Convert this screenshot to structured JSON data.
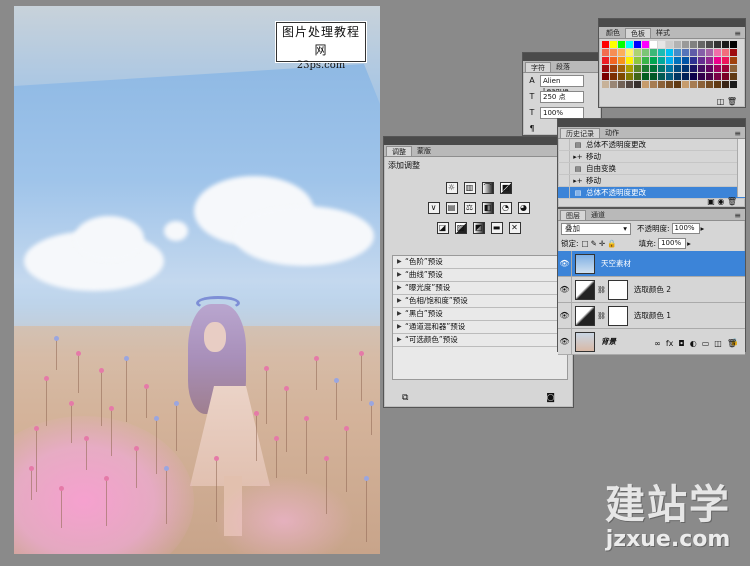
{
  "watermark": {
    "line1": "图片处理教程网",
    "line2": "23ps.com"
  },
  "adjustments": {
    "tabs": [
      "调整",
      "蒙版"
    ],
    "heading": "添加调整",
    "icon_rows": [
      [
        "brightness-contrast-icon",
        "levels-icon",
        "curves-icon",
        "exposure-icon"
      ],
      [
        "vibrance-icon",
        "hue-saturation-icon",
        "color-balance-icon",
        "black-white-icon",
        "photo-filter-icon",
        "channel-mixer-icon"
      ],
      [
        "invert-icon",
        "posterize-icon",
        "threshold-icon",
        "gradient-map-icon",
        "selective-color-icon"
      ]
    ],
    "presets": [
      "“色阶”预设",
      "“曲线”预设",
      "“曝光度”预设",
      "“色相/饱和度”预设",
      "“黑白”预设",
      "“通道混和器”预设",
      "“可选颜色”预设"
    ]
  },
  "character": {
    "tabs": [
      "字符",
      "段落"
    ],
    "font": "Alien League",
    "size": "250 点",
    "scale": "100%"
  },
  "swatches": {
    "tabs": [
      "颜色",
      "色板",
      "样式"
    ],
    "colors": [
      "#ff0000",
      "#ffff00",
      "#00ff00",
      "#00ffff",
      "#0000ff",
      "#ff00ff",
      "#ffffff",
      "#e6e6e6",
      "#cccccc",
      "#b3b3b3",
      "#999999",
      "#808080",
      "#666666",
      "#4d4d4d",
      "#333333",
      "#1a1a1a",
      "#000000",
      "#f26c4f",
      "#f68e55",
      "#fbaf5c",
      "#fff467",
      "#acd372",
      "#7cc576",
      "#3bb878",
      "#1abbb4",
      "#00bff3",
      "#438cca",
      "#5574b9",
      "#605ca8",
      "#855fa8",
      "#a763a8",
      "#f06ea9",
      "#f26d7d",
      "#9e0b0f",
      "#ed1c24",
      "#f26522",
      "#f7941d",
      "#fff200",
      "#8dc73f",
      "#39b54a",
      "#00a651",
      "#00a99d",
      "#00aeef",
      "#0072bc",
      "#0054a6",
      "#2e3192",
      "#662d91",
      "#92278f",
      "#ec008c",
      "#ed145b",
      "#a0410d",
      "#9e0b0f",
      "#a0410d",
      "#a3620a",
      "#aba000",
      "#598527",
      "#1a7b30",
      "#007236",
      "#00746b",
      "#0076a3",
      "#004b80",
      "#003471",
      "#1b1464",
      "#440e62",
      "#630460",
      "#9e005d",
      "#9e0039",
      "#8c6239",
      "#790000",
      "#7b2e00",
      "#7d4900",
      "#827b00",
      "#406618",
      "#005e20",
      "#005826",
      "#005952",
      "#005b7f",
      "#003663",
      "#002157",
      "#0d004c",
      "#32004b",
      "#4b0049",
      "#7b0046",
      "#7a0026",
      "#603913",
      "#c7b299",
      "#998675",
      "#736357",
      "#534741",
      "#37302d",
      "#c69c6d",
      "#a67c52",
      "#8c6239",
      "#754c24",
      "#603913",
      "#c69c6d",
      "#a67c52",
      "#8c6239",
      "#754c24",
      "#603913",
      "#3a2414",
      "#1a1a1a"
    ]
  },
  "history": {
    "tabs": [
      "历史记录",
      "动作"
    ],
    "items": [
      {
        "label": "总体不透明度更改",
        "icon": "history-step-icon",
        "selected": false
      },
      {
        "label": "移动",
        "icon": "move-tool-icon",
        "selected": false
      },
      {
        "label": "自由变换",
        "icon": "history-step-icon",
        "selected": false
      },
      {
        "label": "移动",
        "icon": "move-tool-icon",
        "selected": false
      },
      {
        "label": "总体不透明度更改",
        "icon": "history-step-icon",
        "selected": true
      }
    ]
  },
  "layers": {
    "tabs": [
      "图层",
      "通道"
    ],
    "blend_mode": "叠加",
    "opacity_label": "不透明度:",
    "opacity": "100%",
    "lock_label": "锁定:",
    "fill_label": "填充:",
    "fill": "100%",
    "rows": [
      {
        "name": "天空素材",
        "type": "image",
        "selected": true
      },
      {
        "name": "选取颜色 2",
        "type": "adjustment",
        "selected": false
      },
      {
        "name": "选取颜色 1",
        "type": "adjustment",
        "selected": false
      },
      {
        "name": "背景",
        "type": "background",
        "selected": false
      }
    ]
  },
  "logo": {
    "cn": "建站学",
    "en": "jzxue.com"
  }
}
